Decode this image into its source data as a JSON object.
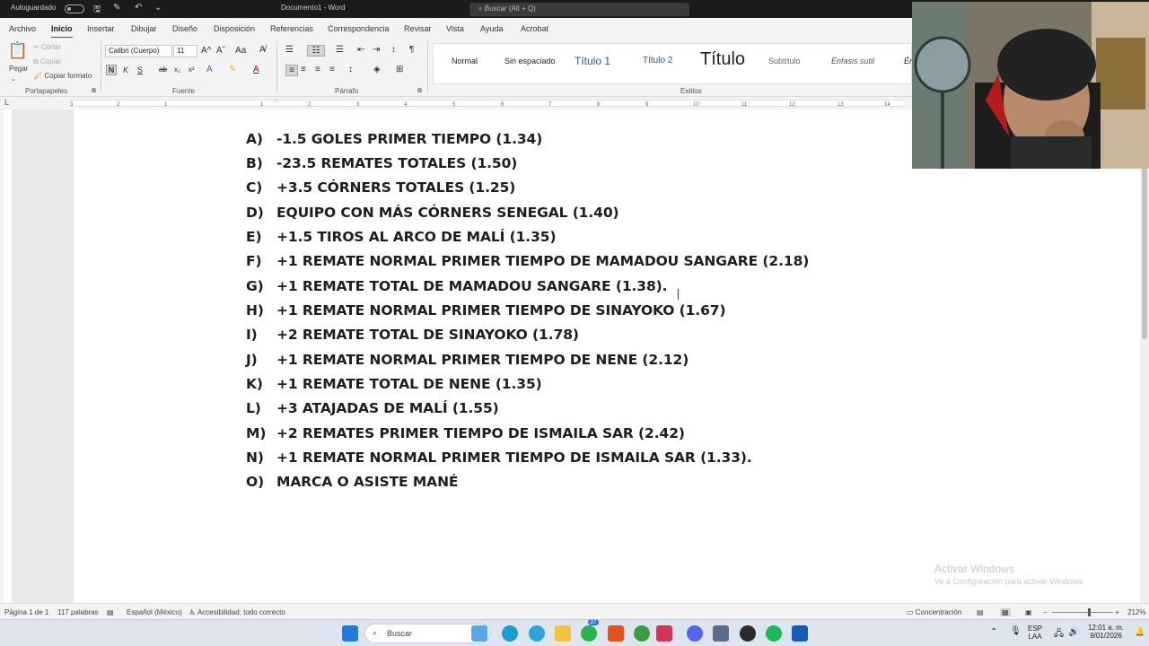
{
  "title_bar": {
    "autosave_label": "Autoguardado",
    "document_name": "Documento1 - Word",
    "search_placeholder": "Buscar (Alt + Q)"
  },
  "ribbon": {
    "tabs": [
      "Archivo",
      "Inicio",
      "Insertar",
      "Dibujar",
      "Diseño",
      "Disposición",
      "Referencias",
      "Correspondencia",
      "Revisar",
      "Vista",
      "Ayuda",
      "Acrobat"
    ],
    "active_tab": "Inicio",
    "clipboard": {
      "paste": "Pegar",
      "cut": "Cortar",
      "copy": "Copiar",
      "format_painter": "Copiar formato",
      "label": "Portapapeles"
    },
    "font": {
      "family": "Calibri (Cuerpo)",
      "size": "11",
      "bold": "N",
      "italic": "K",
      "underline": "S",
      "strike": "ab",
      "subscript": "x₂",
      "superscript": "x²",
      "grow": "A^",
      "shrink": "Aˇ",
      "case": "Aa",
      "label": "Fuente"
    },
    "paragraph": {
      "label": "Párrafo"
    },
    "styles": {
      "items": [
        "Normal",
        "Sin espaciado",
        "Título 1",
        "Título 2",
        "Título",
        "Subtítulo",
        "Énfasis sutil",
        "Én"
      ],
      "label": "Estilos"
    }
  },
  "ruler": {
    "numbers": [
      "3",
      "2",
      "1",
      "1",
      "2",
      "3",
      "4",
      "5",
      "6",
      "7",
      "8",
      "9",
      "10",
      "11",
      "12",
      "13",
      "14"
    ]
  },
  "document": {
    "lines": [
      {
        "letter": "A)",
        "text": "-1.5 GOLES PRIMER TIEMPO (1.34)"
      },
      {
        "letter": "B)",
        "text": "-23.5 REMATES TOTALES (1.50)"
      },
      {
        "letter": "C)",
        "text": "+3.5 CÓRNERS TOTALES (1.25)"
      },
      {
        "letter": "D)",
        "text": "EQUIPO CON MÁS CÓRNERS SENEGAL (1.40)"
      },
      {
        "letter": "E)",
        "text": "+1.5 TIROS AL ARCO DE MALÍ (1.35)"
      },
      {
        "letter": "F)",
        "text": "+1 REMATE NORMAL PRIMER TIEMPO DE MAMADOU SANGARE (2.18)"
      },
      {
        "letter": "G)",
        "text": "+1 REMATE TOTAL DE MAMADOU SANGARE (1.38)."
      },
      {
        "letter": "H)",
        "text": "+1 REMATE NORMAL PRIMER TIEMPO DE SINAYOKO (1.67)"
      },
      {
        "letter": "I)",
        "text": "+2 REMATE TOTAL DE SINAYOKO (1.78)"
      },
      {
        "letter": "J)",
        "text": "+1 REMATE NORMAL PRIMER TIEMPO DE NENE (2.12)"
      },
      {
        "letter": "K)",
        "text": "+1 REMATE TOTAL DE NENE (1.35)"
      },
      {
        "letter": "L)",
        "text": "+3 ATAJADAS DE MALÍ (1.55)"
      },
      {
        "letter": "M)",
        "text": "+2 REMATES PRIMER TIEMPO DE ISMAILA SAR (2.42)"
      },
      {
        "letter": "N)",
        "text": "+1 REMATE NORMAL PRIMER TIEMPO DE ISMAILA SAR (1.33)."
      },
      {
        "letter": "O)",
        "text": "MARCA O ASISTE MANÉ"
      }
    ]
  },
  "watermark": {
    "line1": "Activar Windows",
    "line2": "Ve a Configuración para activar Windows."
  },
  "status_bar": {
    "page": "Página 1 de 1",
    "words": "117 palabras",
    "language": "Español (México)",
    "accessibility": "Accesibilidad: todo correcto",
    "focus": "Concentración",
    "zoom": "212%"
  },
  "taskbar": {
    "search_placeholder": "Buscar",
    "badge_count": "37",
    "language_line1": "ESP",
    "language_line2": "LAA",
    "time": "12:01 a. m.",
    "date": "9/01/2026"
  },
  "colors": {
    "accent": "#185abd",
    "ribbon_bg": "#f3f3f3",
    "titlebar_bg": "#1b1b1b"
  }
}
